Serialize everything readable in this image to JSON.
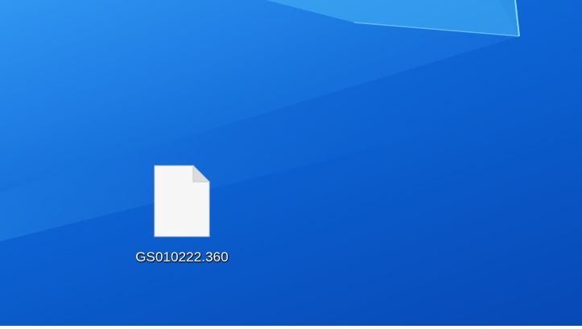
{
  "desktop": {
    "icons": [
      {
        "label": "GS010222.360",
        "icon": "blank-file-icon"
      }
    ]
  },
  "colors": {
    "wallpaper_light": "#1a7ee6",
    "wallpaper_dark": "#0748b4",
    "window_glow": "#5fd3ff"
  }
}
